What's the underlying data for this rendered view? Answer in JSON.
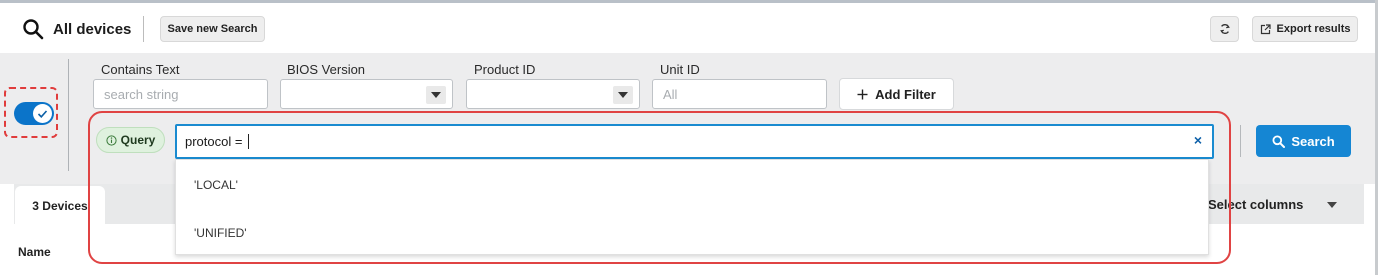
{
  "header": {
    "title": "All devices",
    "save_search_label": "Save new Search",
    "export_label": "Export results"
  },
  "filters": {
    "contains_text": {
      "label": "Contains Text",
      "placeholder": "search string"
    },
    "bios_version": {
      "label": "BIOS Version",
      "value": ""
    },
    "product_id": {
      "label": "Product ID",
      "value": ""
    },
    "unit_id": {
      "label": "Unit ID",
      "placeholder": "All"
    },
    "add_filter_label": "Add Filter"
  },
  "query": {
    "pill_label": "Query",
    "input_value": "protocol = ",
    "clear_symbol": "×",
    "suggestions": [
      "'LOCAL'",
      "'UNIFIED'"
    ]
  },
  "search_button_label": "Search",
  "results": {
    "tab_label": "3 Devices",
    "select_columns_label": "Select columns",
    "first_column": "Name"
  },
  "colors": {
    "accent": "#1586d3",
    "toggle_on": "#0b74c9",
    "highlight_red": "#e04343",
    "query_pill_bg": "#dff1de"
  },
  "icons": {
    "search": "search-icon",
    "refresh": "refresh-icon",
    "export": "export-icon",
    "plus": "plus-icon",
    "info": "info-icon",
    "check": "check-icon"
  }
}
